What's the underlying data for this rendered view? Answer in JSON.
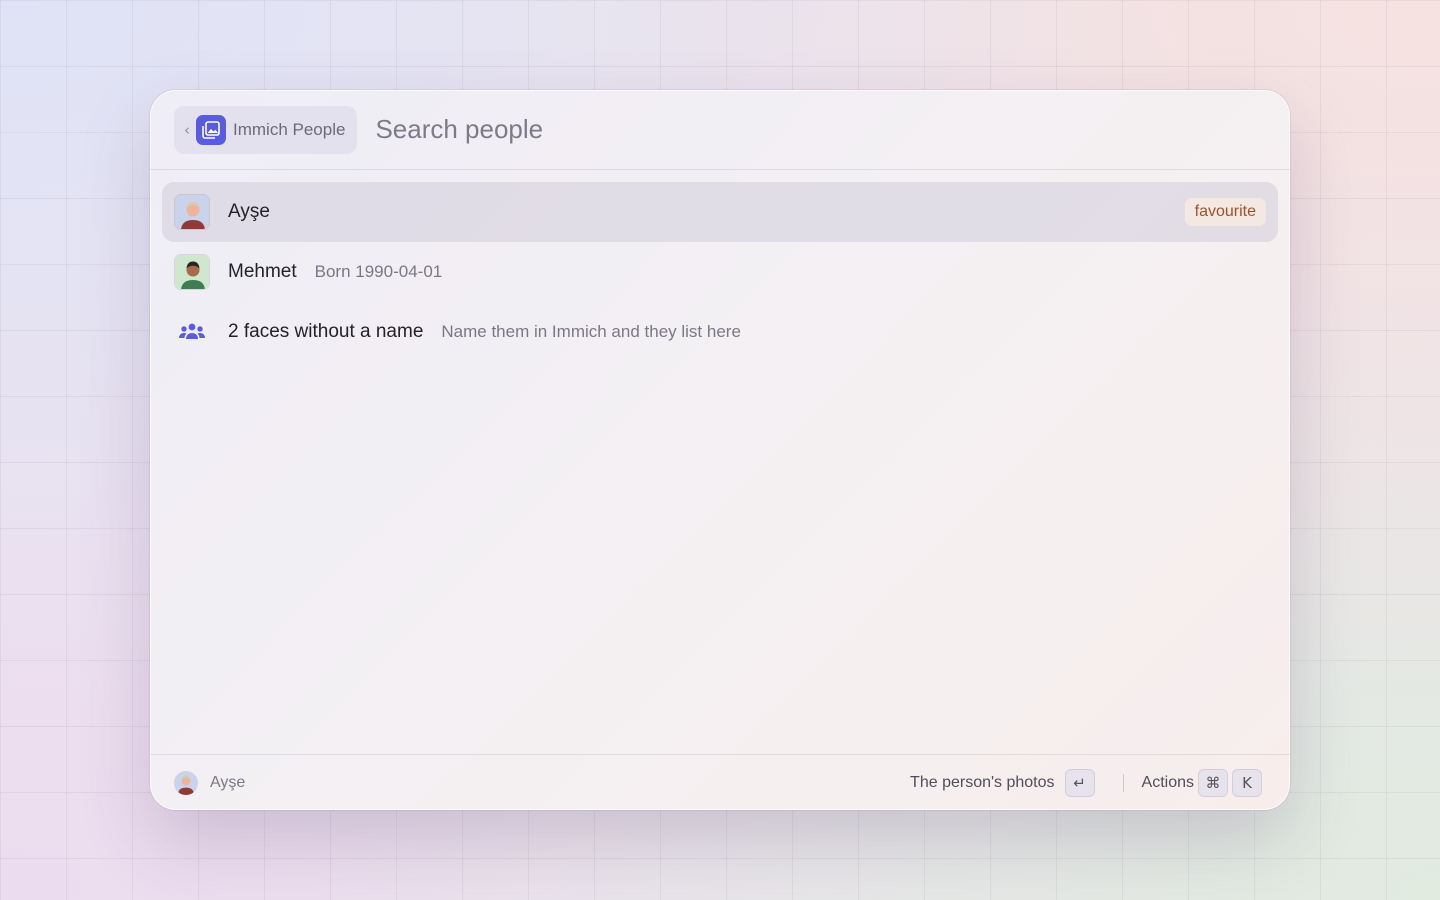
{
  "header": {
    "extension_name": "Immich People",
    "search_placeholder": "Search people",
    "icons": {
      "back": "chevron-left-icon",
      "extension": "photo-icon"
    }
  },
  "list": {
    "items": [
      {
        "title": "Ayşe",
        "subtitle": "",
        "tag": "favourite",
        "avatar": "person-avatar-icon",
        "selected": true
      },
      {
        "title": "Mehmet",
        "subtitle": "Born 1990-04-01",
        "tag": "",
        "avatar": "person-avatar-icon",
        "selected": false
      },
      {
        "title": "2 faces without a name",
        "subtitle": "Name them in Immich and they list here",
        "tag": "",
        "avatar": "people-group-icon",
        "selected": false
      }
    ]
  },
  "footer": {
    "selected_name": "Ayşe",
    "primary_action": "The person's photos",
    "primary_key": "↵",
    "secondary_action": "Actions",
    "secondary_keys": [
      "⌘",
      "K"
    ]
  },
  "colors": {
    "accent": "#5a5ce0",
    "tag_text": "#a0522d",
    "tag_bg": "#f3e8e2"
  }
}
